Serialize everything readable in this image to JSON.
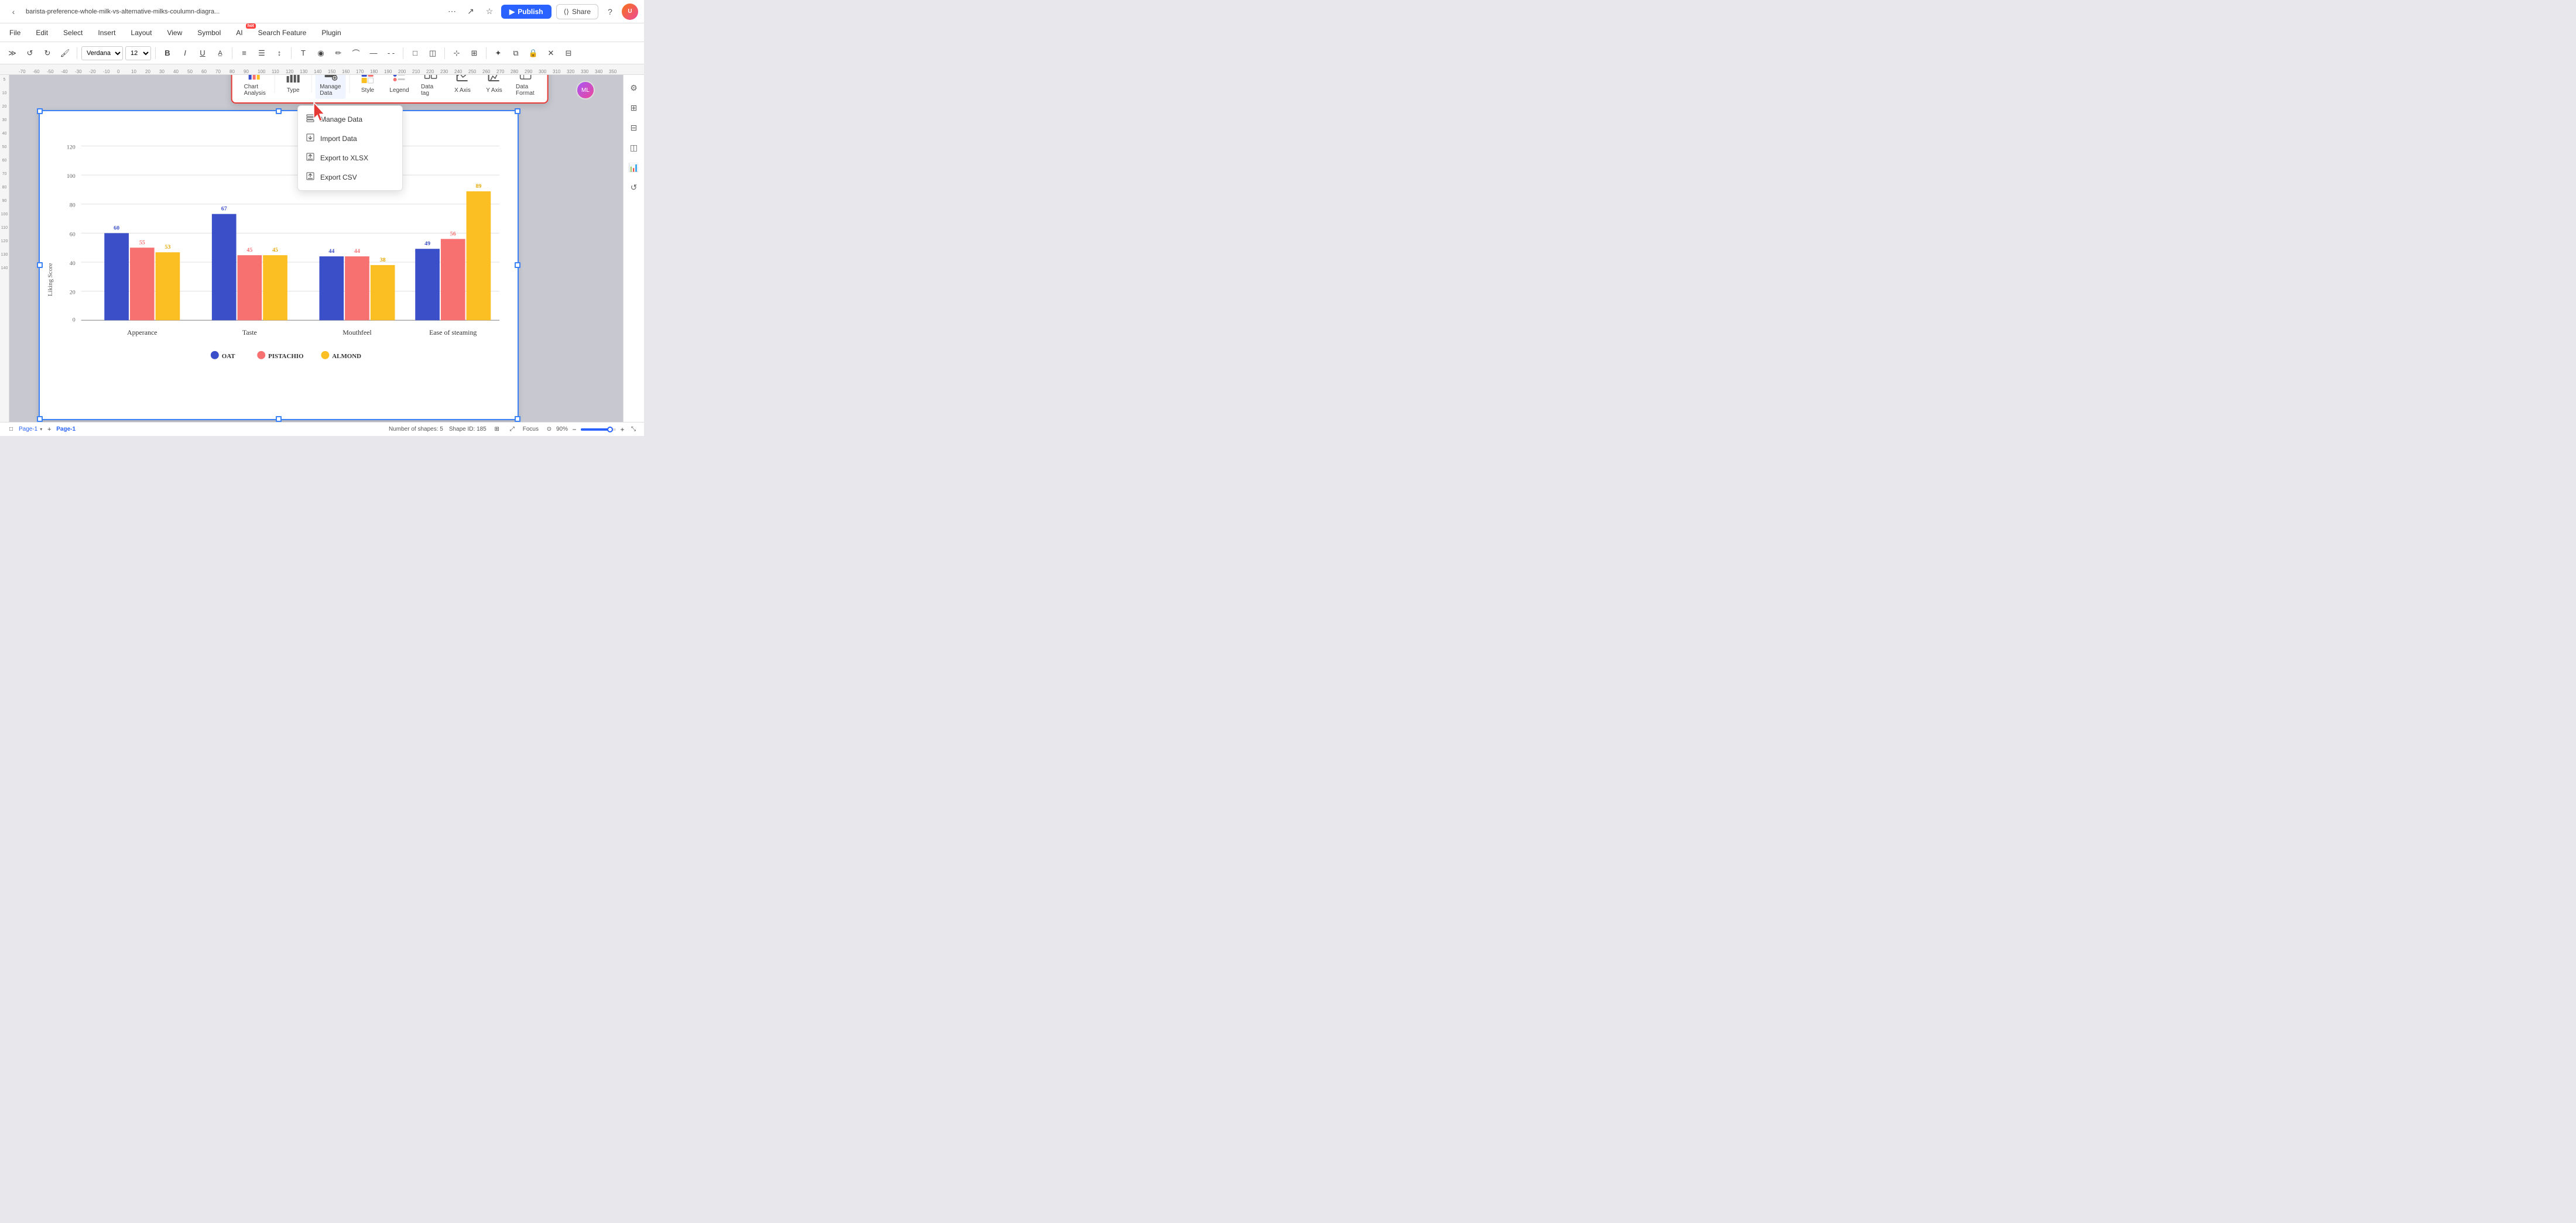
{
  "window": {
    "title": "barista-preference-whole-milk-vs-alternative-milks-coulumn-diagra..."
  },
  "topbar": {
    "back_label": "‹",
    "publish_label": "Publish",
    "share_label": "Share",
    "help_icon": "?",
    "avatar_initials": "U"
  },
  "menubar": {
    "items": [
      {
        "id": "file",
        "label": "File"
      },
      {
        "id": "edit",
        "label": "Edit"
      },
      {
        "id": "select",
        "label": "Select"
      },
      {
        "id": "insert",
        "label": "Insert"
      },
      {
        "id": "layout",
        "label": "Layout"
      },
      {
        "id": "view",
        "label": "View"
      },
      {
        "id": "symbol",
        "label": "Symbol"
      },
      {
        "id": "ai",
        "label": "AI",
        "badge": "hot"
      },
      {
        "id": "search",
        "label": "Search Feature"
      },
      {
        "id": "plugin",
        "label": "Plugin"
      }
    ]
  },
  "toolbar": {
    "font_family": "Verdana",
    "font_size": "12",
    "buttons": [
      "undo",
      "redo",
      "format",
      "bold",
      "italic",
      "underline",
      "font-color",
      "align-left",
      "align-center",
      "line-spacing",
      "text",
      "fill",
      "stroke",
      "connector",
      "line",
      "dash",
      "border",
      "shadow",
      "more1",
      "more2",
      "cursor",
      "crop",
      "lock",
      "delete",
      "table"
    ]
  },
  "float_toolbar": {
    "items": [
      {
        "id": "chart-analysis",
        "label": "Chart Analysis",
        "icon": "📊"
      },
      {
        "id": "type",
        "label": "Type",
        "icon": "📊"
      },
      {
        "id": "manage-data",
        "label": "Manage Data",
        "icon": "📋"
      },
      {
        "id": "style",
        "label": "Style",
        "icon": "✏️"
      },
      {
        "id": "legend",
        "label": "Legend",
        "icon": "🗃"
      },
      {
        "id": "data-tag",
        "label": "Data tag",
        "icon": "🏷"
      },
      {
        "id": "x-axis",
        "label": "X Axis",
        "icon": "↔"
      },
      {
        "id": "y-axis",
        "label": "Y Axis",
        "icon": "↕"
      },
      {
        "id": "data-format",
        "label": "Data Format",
        "icon": "📄"
      }
    ],
    "pin_icon": "📌"
  },
  "manage_data_tooltip": {
    "label": "Manage Data"
  },
  "dropdown_menu": {
    "items": [
      {
        "id": "manage-data",
        "label": "Manage Data",
        "icon": "📋"
      },
      {
        "id": "import-data",
        "label": "Import Data",
        "icon": "📥"
      },
      {
        "id": "export-xlsx",
        "label": "Export to XLSX",
        "icon": "📤"
      },
      {
        "id": "export-csv",
        "label": "Export CSV",
        "icon": "📤"
      }
    ]
  },
  "chart": {
    "title": "",
    "y_axis_label": "Liking Score",
    "y_ticks": [
      "0",
      "20",
      "40",
      "60",
      "80",
      "100",
      "120"
    ],
    "categories": [
      "Apperance",
      "Taste",
      "Mouthfeel",
      "Ease of steaming"
    ],
    "legend": [
      {
        "id": "oat",
        "label": "OAT",
        "color": "#3b4fc8"
      },
      {
        "id": "pistachio",
        "label": "PISTACHIO",
        "color": "#f87171"
      },
      {
        "id": "almond",
        "label": "ALMOND",
        "color": "#fbbf24"
      }
    ],
    "series": {
      "oat": [
        60,
        67,
        44,
        49
      ],
      "pistachio": [
        55,
        45,
        44,
        56
      ],
      "almond": [
        53,
        45,
        38,
        89
      ]
    }
  },
  "bottombar": {
    "page_label": "Page-1",
    "page_name": "Page-1",
    "add_page_icon": "+",
    "shapes_count": "Number of shapes: 5",
    "shape_id": "Shape ID: 185",
    "focus_label": "Focus",
    "zoom_level": "90%"
  }
}
